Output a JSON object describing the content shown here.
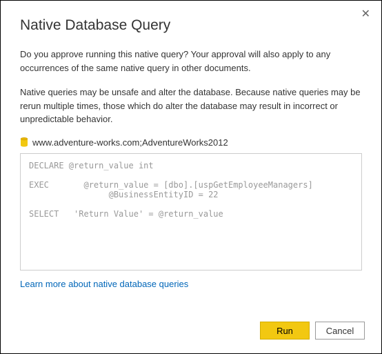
{
  "dialog": {
    "title": "Native Database Query",
    "close_symbol": "✕",
    "paragraph1": "Do you approve running this native query? Your approval will also apply to any occurrences of the same native query in other documents.",
    "paragraph2": "Native queries may be unsafe and alter the database. Because native queries may be rerun multiple times, those which do alter the database may result in incorrect or unpredictable behavior.",
    "database_label": "www.adventure-works.com;AdventureWorks2012",
    "query_text": "DECLARE @return_value int\n\nEXEC       @return_value = [dbo].[uspGetEmployeeManagers]\n                @BusinessEntityID = 22\n\nSELECT   'Return Value' = @return_value",
    "learn_more_link": "Learn more about native database queries",
    "buttons": {
      "run": "Run",
      "cancel": "Cancel"
    }
  }
}
